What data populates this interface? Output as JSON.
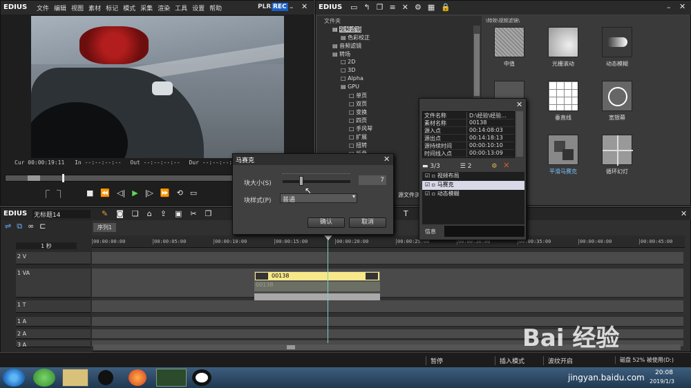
{
  "player": {
    "brand": "EDIUS",
    "menu": [
      "文件",
      "编辑",
      "视图",
      "素材",
      "标记",
      "模式",
      "采集",
      "渲染",
      "工具",
      "设置",
      "帮助"
    ],
    "plr": "PLR",
    "rec": "REC",
    "cur_label": "Cur",
    "cur": "00:00:19:11",
    "in_label": "In",
    "in": "--:--:--:--",
    "out_label": "Out",
    "out": "--:--:--:--",
    "dur_label": "Dur",
    "dur": "--:--:--:--"
  },
  "bin": {
    "brand": "EDIUS",
    "folder_header": "文件夹",
    "path": "\\特效\\视频滤镜\\",
    "tree": [
      "视频滤镜",
      "色彩校正",
      "音频滤镜",
      "转场",
      "2D",
      "3D",
      "Alpha",
      "GPU",
      "单页",
      "双页",
      "变换",
      "四页",
      "手风琴",
      "扩展",
      "扭转",
      "折叠"
    ],
    "thumbs": [
      "中值",
      "光栅滚动",
      "动态模糊",
      "",
      "垂直线",
      "宽银幕",
      "",
      "平滑马赛克",
      "循环幻灯"
    ]
  },
  "dialog": {
    "title": "马赛克",
    "size_label": "块大小(S)",
    "size_value": "7",
    "style_label": "块样式(P)",
    "style_value": "普通",
    "ok": "确认",
    "cancel": "取消"
  },
  "info": {
    "rows": [
      [
        "文件名称",
        "D:\\经验\\经验..."
      ],
      [
        "素材名称",
        "00138"
      ],
      [
        "源入点",
        "00:14:08:03"
      ],
      [
        "源出点",
        "00:14:18:13"
      ],
      [
        "源持续时间",
        "00:00:10:10"
      ],
      [
        "时间线入点",
        "00:00:13:09"
      ]
    ],
    "count": "3/3",
    "count2": "2",
    "layers": [
      "视频布局",
      "马赛克",
      "动态模糊"
    ],
    "footer": "信息",
    "source_tab": "源文件浏"
  },
  "timeline": {
    "brand": "EDIUS",
    "project": "无标题14",
    "sequence": "序列1",
    "scale": "1 秒",
    "ruler": [
      "00:00:00:00",
      "00:00:05:00",
      "00:00:10:00",
      "00:00:15:00",
      "00:00:20:00",
      "00:00:25:00",
      "00:00:30:00",
      "00:00:35:00",
      "00:00:40:00",
      "00:00:45:00"
    ],
    "tracks": [
      "2 V",
      "1 VA",
      "1 T",
      "1 A",
      "2 A",
      "3 A"
    ],
    "clip": "00138",
    "clip_ghost": "00138"
  },
  "status": {
    "pause": "暂停",
    "insert": "插入模式",
    "ripple": "波纹开启",
    "disk": "磁盘 52% 被使用(D:)"
  },
  "taskbar": {
    "time": "20:08",
    "date": "2019/1/3"
  },
  "watermark": {
    "text": "Bai  经验",
    "url": "jingyan.baidu.com"
  }
}
